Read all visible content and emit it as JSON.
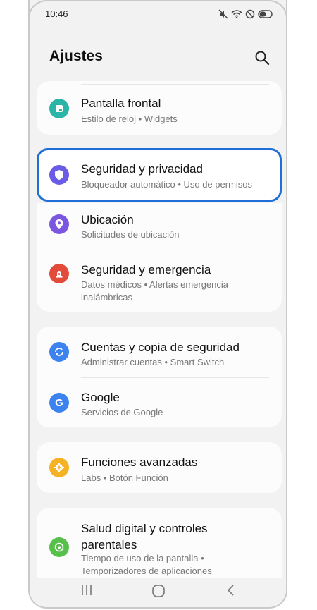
{
  "status": {
    "time": "10:46",
    "icons": [
      "mute-icon",
      "wifi-icon",
      "dnd-icon",
      "battery-icon"
    ]
  },
  "header": {
    "title": "Ajustes",
    "search_icon": "search-icon"
  },
  "items": {
    "cover_screen": {
      "title": "Pantalla frontal",
      "subtitle": "Estilo de reloj  •  Widgets",
      "icon": "cover-screen-icon",
      "color": "#2bb5a8"
    },
    "security": {
      "title": "Seguridad y privacidad",
      "subtitle": "Bloqueador automático  •  Uso de permisos",
      "icon": "shield-icon",
      "color": "#6b5ce7"
    },
    "location": {
      "title": "Ubicación",
      "subtitle": "Solicitudes de ubicación",
      "icon": "location-pin-icon",
      "color": "#7b56e0"
    },
    "emergency": {
      "title": "Seguridad y emergencia",
      "subtitle": "Datos médicos  •  Alertas emergencia inalámbricas",
      "icon": "emergency-icon",
      "color": "#e24a3a"
    },
    "accounts": {
      "title": "Cuentas y copia de seguridad",
      "subtitle": "Administrar cuentas  •  Smart Switch",
      "icon": "sync-icon",
      "color": "#3d83ef"
    },
    "google": {
      "title": "Google",
      "subtitle": "Servicios de Google",
      "icon": "google-icon",
      "color": "#3d83ef"
    },
    "advanced": {
      "title": "Funciones avanzadas",
      "subtitle": "Labs  •  Botón Función",
      "icon": "gear-plus-icon",
      "color": "#f5b324"
    },
    "digital_wellbeing": {
      "title": "Salud digital y controles parentales",
      "subtitle": "Tiempo de uso de la pantalla  •  Temporizadores de aplicaciones",
      "icon": "wellbeing-icon",
      "color": "#56c04a"
    }
  },
  "nav": [
    "recent-apps-icon",
    "home-icon",
    "back-icon"
  ]
}
